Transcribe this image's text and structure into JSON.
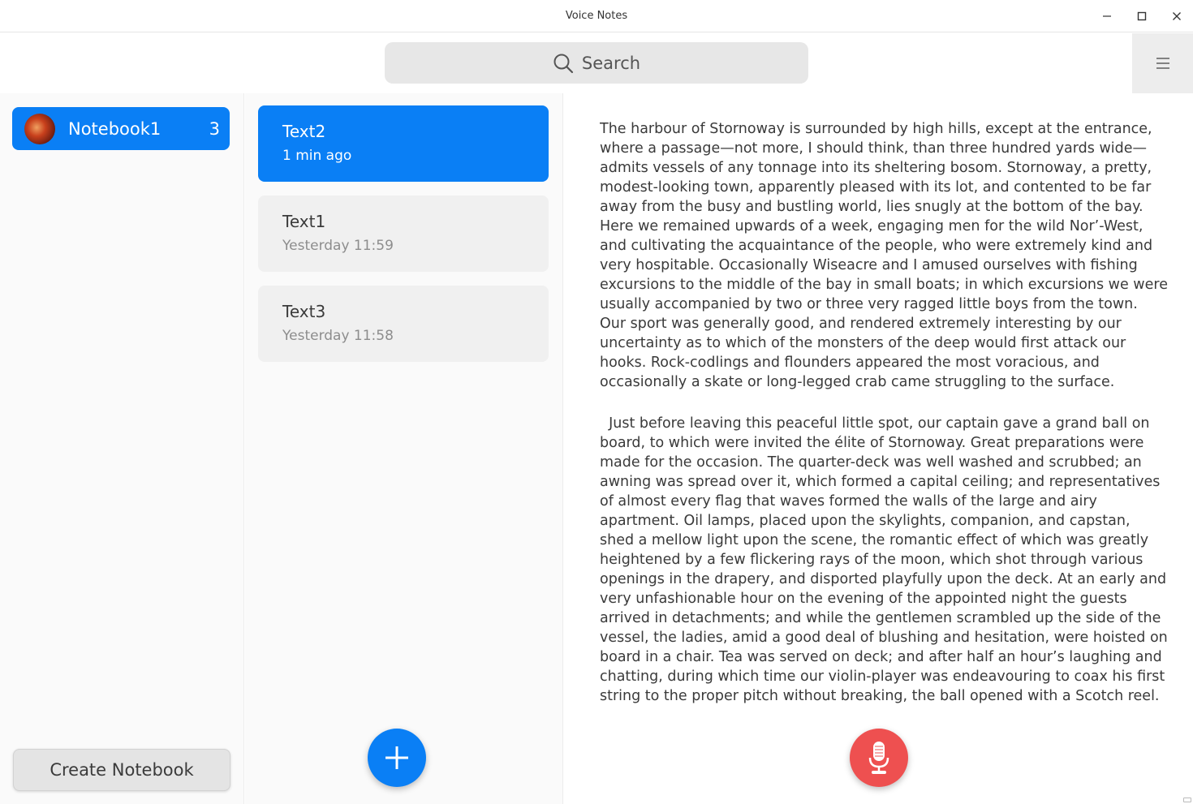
{
  "window": {
    "title": "Voice Notes"
  },
  "toolbar": {
    "search_label": "Search",
    "search_icon": "search-icon",
    "menu_icon": "hamburger-menu-icon"
  },
  "sidebar": {
    "notebooks": [
      {
        "name": "Notebook1",
        "count": "3",
        "selected": true
      }
    ],
    "create_button_label": "Create Notebook"
  },
  "notes": [
    {
      "title": "Text2",
      "time": "1 min ago",
      "selected": true
    },
    {
      "title": "Text1",
      "time": "Yesterday 11:59",
      "selected": false
    },
    {
      "title": "Text3",
      "time": "Yesterday 11:58",
      "selected": false
    }
  ],
  "editor": {
    "paragraphs": [
      "The harbour of Stornoway is surrounded by high hills, except at the entrance, where a passage—not more, I should think, than three hundred yards wide—admits vessels of any tonnage into its sheltering bosom. Stornoway, a pretty, modest-looking town, apparently pleased with its lot, and contented to be far away from the busy and bustling world, lies snugly at the bottom of the bay. Here we remained upwards of a week, engaging men for the wild Nor’-West, and cultivating the acquaintance of the people, who were extremely kind and very hospitable. Occasionally Wiseacre and I amused ourselves with fishing excursions to the middle of the bay in small boats; in which excursions we were usually accompanied by two or three very ragged little boys from the town. Our sport was generally good, and rendered extremely interesting by our uncertainty as to which of the monsters of the deep would first attack our hooks. Rock-codlings and flounders appeared the most voracious, and occasionally a skate or long-legged crab came struggling to the surface.",
      "  Just before leaving this peaceful little spot, our captain gave a grand ball on board, to which were invited the élite of Stornoway. Great preparations were made for the occasion. The quarter-deck was well washed and scrubbed; an awning was spread over it, which formed a capital ceiling; and representatives of almost every flag that waves formed the walls of the large and airy apartment. Oil lamps, placed upon the skylights, companion, and capstan, shed a mellow light upon the scene, the romantic effect of which was greatly heightened by a few flickering rays of the moon, which shot through various openings in the drapery, and disported playfully upon the deck. At an early and very unfashionable hour on the evening of the appointed night the guests arrived in detachments; and while the gentlemen scrambled up the side of the vessel, the ladies, amid a good deal of blushing and hesitation, were hoisted on board in a chair. Tea was served on deck; and after half an hour’s laughing and chatting, during which time our violin-player was endeavouring to coax his first string to the proper pitch without breaking, the ball opened with a Scotch reel. Every one"
    ]
  },
  "actions": {
    "add_note_icon": "plus-icon",
    "record_icon": "microphone-icon"
  },
  "colors": {
    "accent": "#0a7ff5",
    "record": "#ee5050"
  }
}
